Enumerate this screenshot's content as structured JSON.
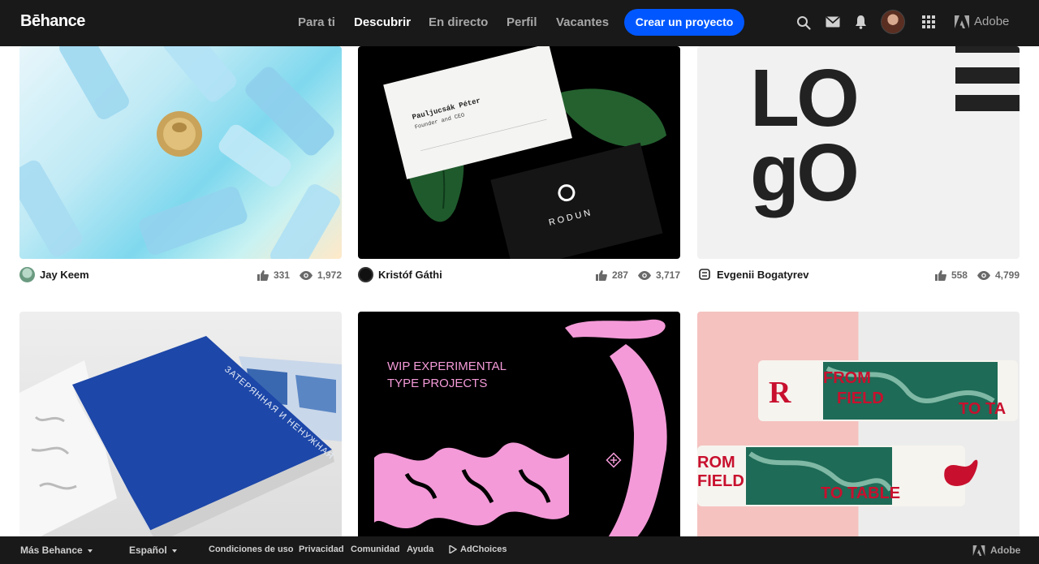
{
  "header": {
    "logo": "Bēhance",
    "nav": [
      "Para ti",
      "Descubrir",
      "En directo",
      "Perfil",
      "Vacantes"
    ],
    "active_nav": "Descubrir",
    "cta": "Crear un proyecto",
    "adobe_label": "Adobe",
    "icons": [
      "search-icon",
      "mail-icon",
      "bell-icon",
      "user-avatar",
      "apps-grid-icon",
      "adobe-logo-icon"
    ]
  },
  "projects": [
    {
      "owner": "Jay Keem",
      "likes": "331",
      "views": "1,972"
    },
    {
      "owner": "Kristóf Gáthi",
      "likes": "287",
      "views": "3,717",
      "card_name": "Pauljucsák Péter",
      "card_role": "Founder and CEO",
      "brand": "RODUN"
    },
    {
      "owner": "Evgenii Bogatyrev",
      "likes": "558",
      "views": "4,799",
      "logo_lines": [
        "LO",
        "gO"
      ]
    },
    {
      "cover_text": "ЗАТЕРЯННАЯ И НЕНУЖНАЯ"
    },
    {
      "headline_1": "WIP EXPERIMENTAL",
      "headline_2": "TYPE PROJECTS"
    },
    {
      "word_1": "FROM",
      "word_2": "FIELD",
      "word_3": "TO TA",
      "word_4": "ROM",
      "word_5": "FIELD",
      "word_6": "TO TABLE",
      "mark": "R"
    }
  ],
  "footer": {
    "more": "Más Behance",
    "language": "Español",
    "links": [
      "Condiciones de uso",
      "Privacidad",
      "Comunidad",
      "Ayuda"
    ],
    "adchoices": "AdChoices",
    "adobe_label": "Adobe"
  },
  "colors": {
    "topbar": "#191919",
    "cta": "#0057ff",
    "nav_inactive": "#a8a8a8",
    "pink": "#f49ad8",
    "red": "#c8102e"
  }
}
